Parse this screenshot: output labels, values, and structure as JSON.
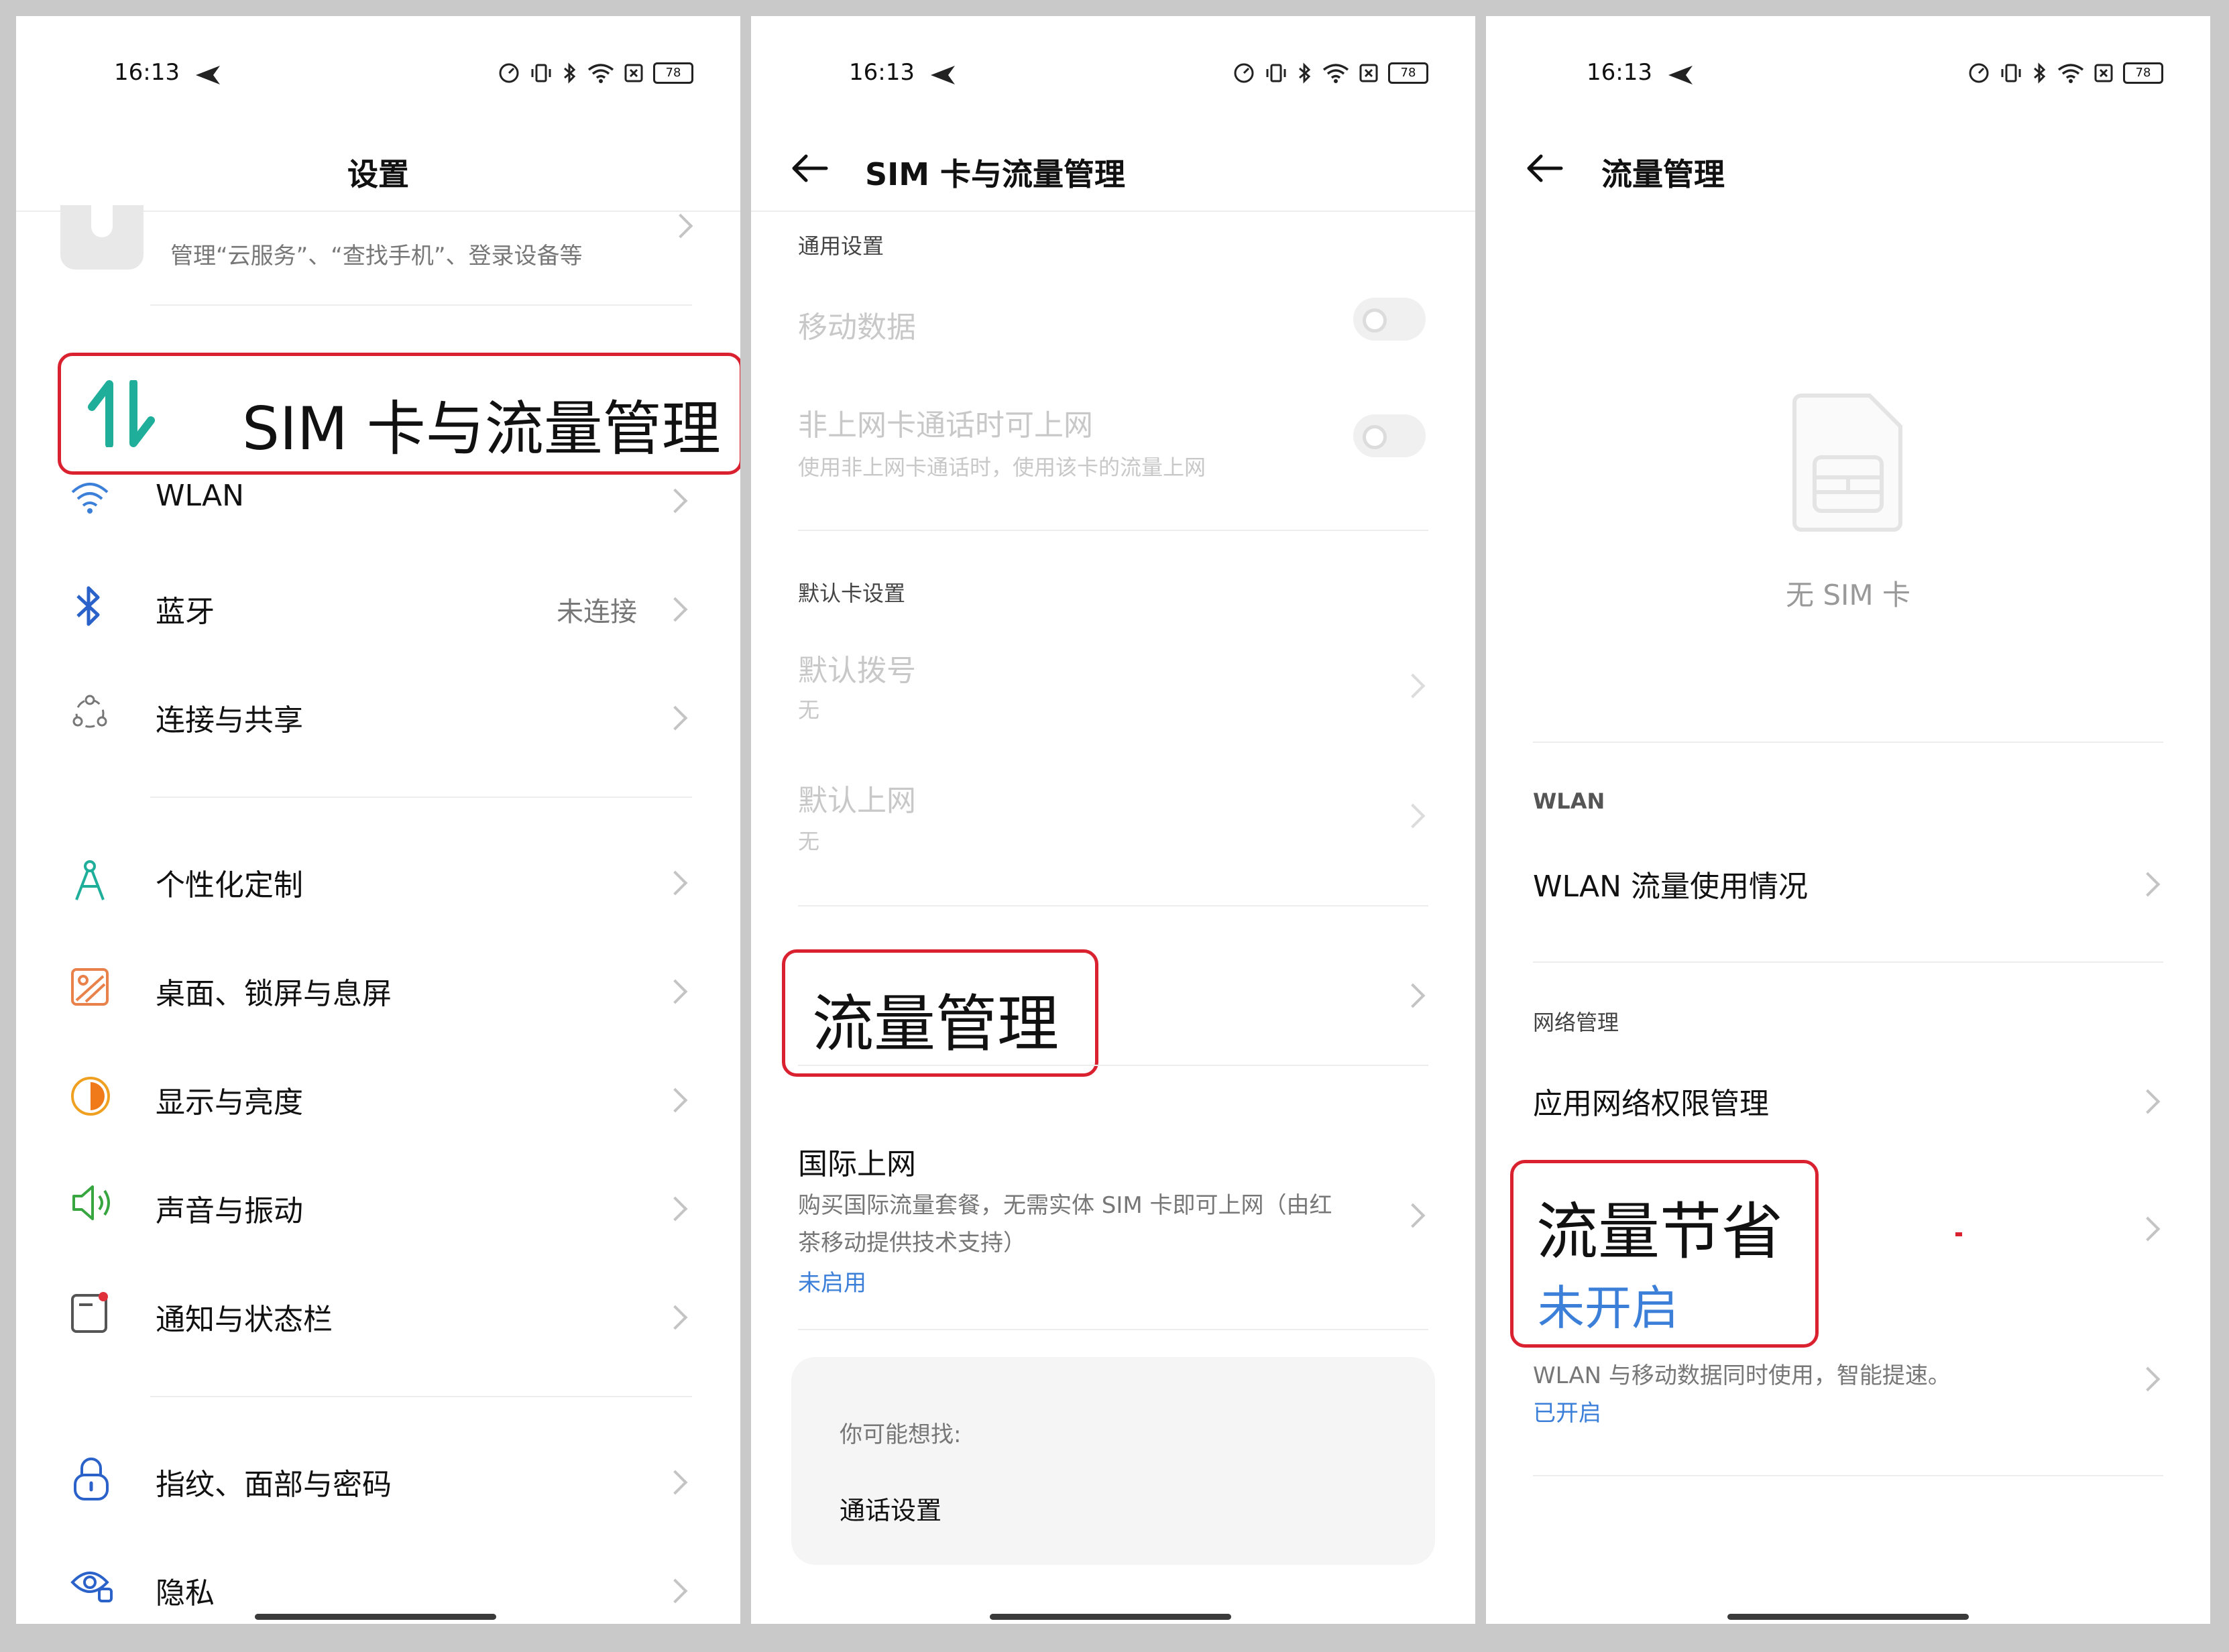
{
  "status": {
    "time": "16:13",
    "battery": "78"
  },
  "p1": {
    "title": "设置",
    "account_subtitle": "管理“云服务”、“查找手机”、登录设备等",
    "sim_label": "SIM 卡与流量管理",
    "items": [
      {
        "label": "WLAN"
      },
      {
        "label": "蓝牙",
        "value": "未连接"
      },
      {
        "label": "连接与共享"
      },
      {
        "label": "个性化定制"
      },
      {
        "label": "桌面、锁屏与息屏"
      },
      {
        "label": "显示与亮度"
      },
      {
        "label": "声音与振动"
      },
      {
        "label": "通知与状态栏"
      },
      {
        "label": "指纹、面部与密码"
      },
      {
        "label": "隐私"
      }
    ]
  },
  "p2": {
    "title": "SIM 卡与流量管理",
    "general_section": "通用设置",
    "mobile_data": "移动数据",
    "non_data_call": "非上网卡通话时可上网",
    "non_data_call_desc": "使用非上网卡通话时，使用该卡的流量上网",
    "default_section": "默认卡设置",
    "default_dial": "默认拨号",
    "default_dial_value": "无",
    "default_net": "默认上网",
    "default_net_value": "无",
    "traffic_mgmt": "流量管理",
    "intl_title": "国际上网",
    "intl_desc_1": "购买国际流量套餐，无需实体 SIM 卡即可上网（由红",
    "intl_desc_2": "茶移动提供技术支持）",
    "intl_status": "未启用",
    "suggest_title": "你可能想找:",
    "suggest_item": "通话设置"
  },
  "p3": {
    "title": "流量管理",
    "no_sim": "无 SIM 卡",
    "wlan_section": "WLAN",
    "wlan_usage": "WLAN 流量使用情况",
    "net_section": "网络管理",
    "app_net": "应用网络权限管理",
    "saver_title": "流量节省",
    "saver_status": "未开启",
    "dual_desc": "WLAN 与移动数据同时使用，智能提速。",
    "dual_status": "已开启"
  },
  "colors": {
    "highlight_border": "#d92130",
    "link_blue": "#3b7fd9",
    "sim_icon_teal": "#1fae9a"
  }
}
